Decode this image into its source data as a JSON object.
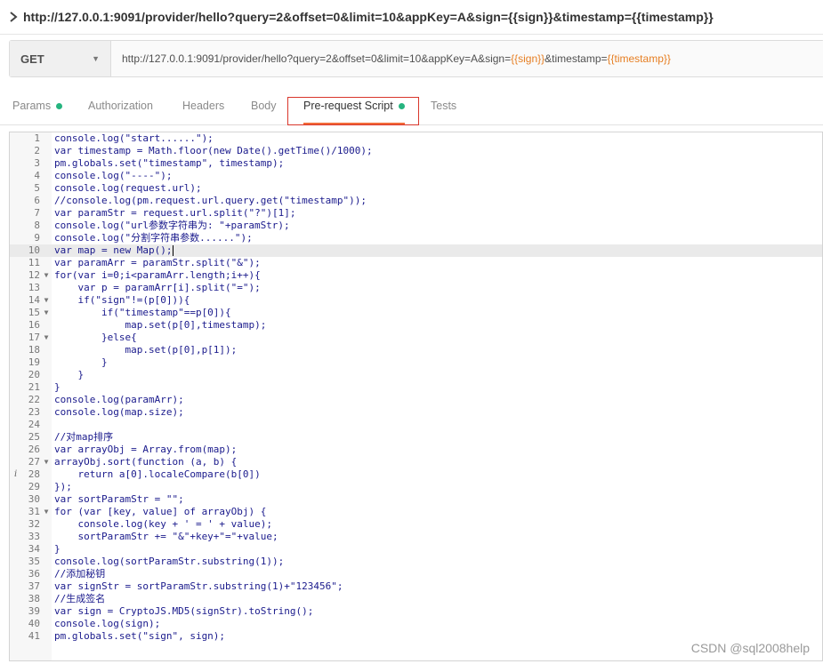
{
  "window": {
    "title": "http://127.0.0.1:9091/provider/hello?query=2&offset=0&limit=10&appKey=A&sign={{sign}}&timestamp={{timestamp}}"
  },
  "request": {
    "method": "GET",
    "url_parts": [
      {
        "text": "http://127.0.0.1:9091/provider/hello?query=2&offset=0&limit=10&appKey=A&sign=",
        "var": false
      },
      {
        "text": "{{sign}}",
        "var": true
      },
      {
        "text": "&timestamp=",
        "var": false
      },
      {
        "text": "{{timestamp}}",
        "var": true
      }
    ]
  },
  "tabs": [
    {
      "label": "Params",
      "dot": true,
      "active": false
    },
    {
      "label": "Authorization",
      "dot": false,
      "active": false
    },
    {
      "label": "Headers",
      "dot": false,
      "active": false
    },
    {
      "label": "Body",
      "dot": false,
      "active": false
    },
    {
      "label": "Pre-request Script",
      "dot": true,
      "active": true
    },
    {
      "label": "Tests",
      "dot": false,
      "active": false
    }
  ],
  "editor": {
    "active_line": 10,
    "cursor_after_line": 10,
    "fold_lines": [
      12,
      14,
      15,
      17,
      27,
      31
    ],
    "info_lines": [
      28
    ],
    "lines": [
      "console.log(\"start......\");",
      "var timestamp = Math.floor(new Date().getTime()/1000);",
      "pm.globals.set(\"timestamp\", timestamp);",
      "console.log(\"----\");",
      "console.log(request.url);",
      "//console.log(pm.request.url.query.get(\"timestamp\"));",
      "var paramStr = request.url.split(\"?\")[1];",
      "console.log(\"url参数字符串为: \"+paramStr);",
      "console.log(\"分割字符串参数......\");",
      "var map = new Map();",
      "var paramArr = paramStr.split(\"&\");",
      "for(var i=0;i<paramArr.length;i++){",
      "    var p = paramArr[i].split(\"=\");",
      "    if(\"sign\"!=(p[0])){",
      "        if(\"timestamp\"==p[0]){",
      "            map.set(p[0],timestamp);",
      "        }else{",
      "            map.set(p[0],p[1]);",
      "        }",
      "    }",
      "}",
      "console.log(paramArr);",
      "console.log(map.size);",
      "",
      "//对map排序",
      "var arrayObj = Array.from(map);",
      "arrayObj.sort(function (a, b) {",
      "    return a[0].localeCompare(b[0])",
      "});",
      "var sortParamStr = \"\";",
      "for (var [key, value] of arrayObj) {",
      "    console.log(key + ' = ' + value);",
      "    sortParamStr += \"&\"+key+\"=\"+value;",
      "}",
      "console.log(sortParamStr.substring(1));",
      "//添加秘钥",
      "var signStr = sortParamStr.substring(1)+\"123456\";",
      "//生成签名",
      "var sign = CryptoJS.MD5(signStr).toString();",
      "console.log(sign);",
      "pm.globals.set(\"sign\", sign);"
    ]
  },
  "watermark": "CSDN @sql2008help"
}
